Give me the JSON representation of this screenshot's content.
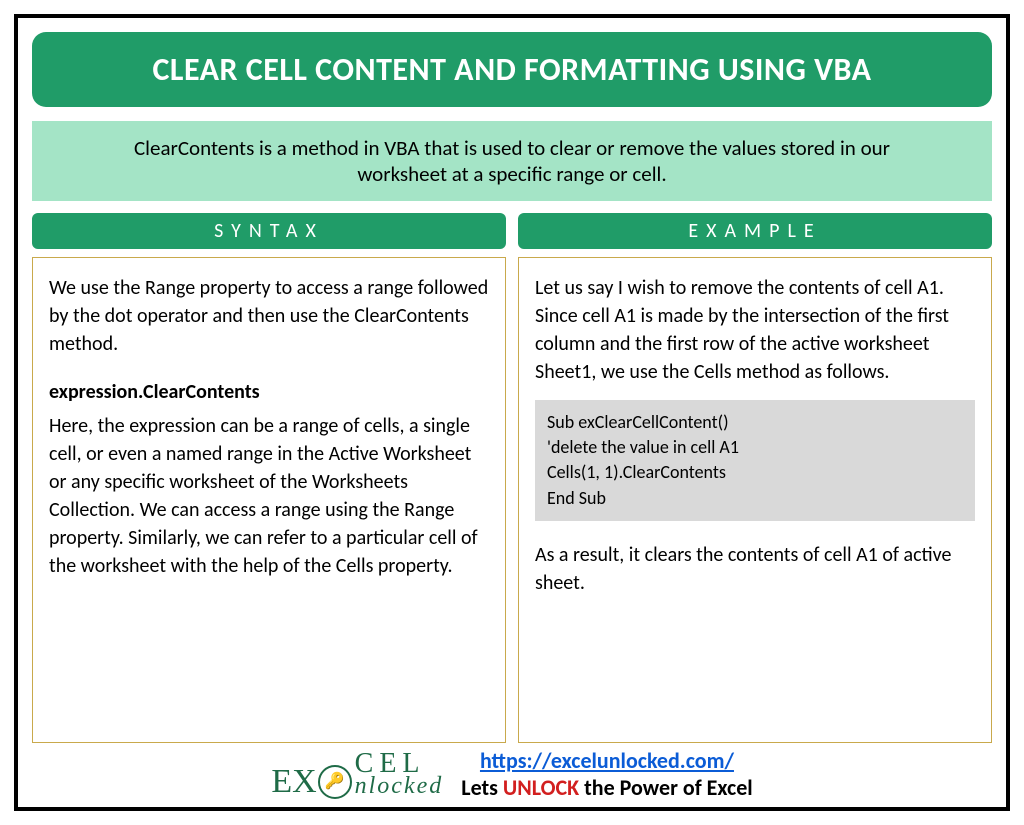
{
  "header": {
    "title": "CLEAR CELL CONTENT AND FORMATTING USING VBA"
  },
  "description": "ClearContents is a method in VBA that is used to clear or remove the values stored in our worksheet at a specific range or cell.",
  "syntax": {
    "label": "SYNTAX",
    "intro": "We use the Range property to access a range followed by the dot operator and then use the ClearContents method.",
    "expression": "expression.ClearContents",
    "explain": "Here, the expression can be a range of cells, a single cell, or even a named range in the Active Worksheet or any specific worksheet of the Worksheets Collection. We can access a range using the Range property. Similarly, we can refer to a particular cell of the worksheet with the help of the Cells property."
  },
  "example": {
    "label": "EXAMPLE",
    "intro": "Let us say I wish to remove the contents of cell A1. Since cell A1 is made by the intersection of the first column and the first row of the active worksheet Sheet1, we use the Cells method as follows.",
    "code": "Sub exClearCellContent()\n'delete the value in cell A1\nCells(1, 1).ClearContents\nEnd Sub",
    "result": "As a result, it clears the contents of cell A1 of active sheet."
  },
  "footer": {
    "url": "https://excelunlocked.com/",
    "tagline_prefix": "Lets ",
    "tagline_highlight": "UNLOCK",
    "tagline_suffix": " the Power of Excel",
    "brand_top": "CEL",
    "brand_bottom": "nlocked",
    "brand_left": "EX",
    "brand_key": "🔑"
  }
}
